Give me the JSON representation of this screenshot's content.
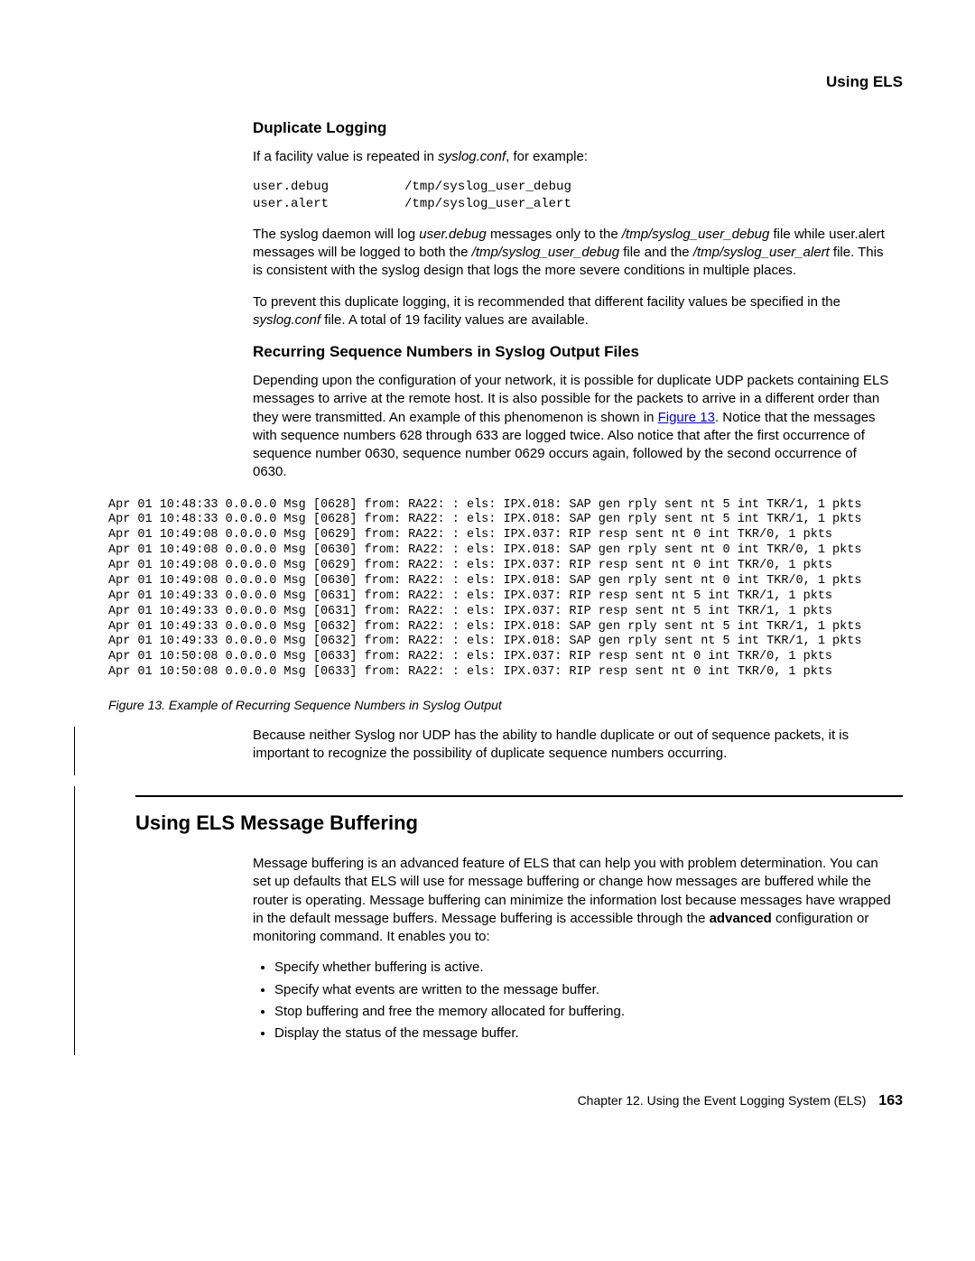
{
  "header": {
    "right": "Using ELS"
  },
  "sec1": {
    "title": "Duplicate Logging",
    "p1a": "If a facility value is repeated in ",
    "p1b": "syslog.conf",
    "p1c": ", for example:",
    "code": "user.debug          /tmp/syslog_user_debug\nuser.alert          /tmp/syslog_user_alert",
    "p2a": "The syslog daemon will log ",
    "p2b": "user.debug",
    "p2c": " messages only to the ",
    "p2d": "/tmp/syslog_user_debug",
    "p2e": " file while user.alert messages will be logged to both the ",
    "p2f": "/tmp/syslog_user_debug",
    "p2g": " file and the ",
    "p2h": "/tmp/syslog_user_alert",
    "p2i": " file. This is consistent with the syslog design that logs the more severe conditions in multiple places.",
    "p3a": "To prevent this duplicate logging, it is recommended that different facility values be specified in the ",
    "p3b": "syslog.conf",
    "p3c": " file. A total of 19 facility values are available."
  },
  "sec2": {
    "title": "Recurring Sequence Numbers in Syslog Output Files",
    "p1a": "Depending upon the configuration of your network, it is possible for duplicate UDP packets containing ELS messages to arrive at the remote host. It is also possible for the packets to arrive in a different order than they were transmitted. An example of this phenomenon is shown in ",
    "p1link": "Figure 13",
    "p1b": ". Notice that the messages with sequence numbers 628 through 633 are logged twice. Also notice that after the first occurrence of sequence number 0630, sequence number 0629 occurs again, followed by the second occurrence of 0630."
  },
  "log": "Apr 01 10:48:33 0.0.0.0 Msg [0628] from: RA22: : els: IPX.018: SAP gen rply sent nt 5 int TKR/1, 1 pkts\nApr 01 10:48:33 0.0.0.0 Msg [0628] from: RA22: : els: IPX.018: SAP gen rply sent nt 5 int TKR/1, 1 pkts\nApr 01 10:49:08 0.0.0.0 Msg [0629] from: RA22: : els: IPX.037: RIP resp sent nt 0 int TKR/0, 1 pkts\nApr 01 10:49:08 0.0.0.0 Msg [0630] from: RA22: : els: IPX.018: SAP gen rply sent nt 0 int TKR/0, 1 pkts\nApr 01 10:49:08 0.0.0.0 Msg [0629] from: RA22: : els: IPX.037: RIP resp sent nt 0 int TKR/0, 1 pkts\nApr 01 10:49:08 0.0.0.0 Msg [0630] from: RA22: : els: IPX.018: SAP gen rply sent nt 0 int TKR/0, 1 pkts\nApr 01 10:49:33 0.0.0.0 Msg [0631] from: RA22: : els: IPX.037: RIP resp sent nt 5 int TKR/1, 1 pkts\nApr 01 10:49:33 0.0.0.0 Msg [0631] from: RA22: : els: IPX.037: RIP resp sent nt 5 int TKR/1, 1 pkts\nApr 01 10:49:33 0.0.0.0 Msg [0632] from: RA22: : els: IPX.018: SAP gen rply sent nt 5 int TKR/1, 1 pkts\nApr 01 10:49:33 0.0.0.0 Msg [0632] from: RA22: : els: IPX.018: SAP gen rply sent nt 5 int TKR/1, 1 pkts\nApr 01 10:50:08 0.0.0.0 Msg [0633] from: RA22: : els: IPX.037: RIP resp sent nt 0 int TKR/0, 1 pkts\nApr 01 10:50:08 0.0.0.0 Msg [0633] from: RA22: : els: IPX.037: RIP resp sent nt 0 int TKR/0, 1 pkts",
  "figcap": "Figure 13. Example of Recurring Sequence Numbers in Syslog Output",
  "afterfig": "Because neither Syslog nor UDP has the ability to handle duplicate or out of sequence packets, it is important to recognize the possibility of duplicate sequence numbers occurring.",
  "sec3": {
    "title": "Using ELS Message Buffering",
    "p1a": "Message buffering is an advanced feature of ELS that can help you with problem determination. You can set up defaults that ELS will use for message buffering or change how messages are buffered while the router is operating. Message buffering can minimize the information lost because messages have wrapped in the default message buffers. Message buffering is accessible through the ",
    "p1b": "advanced",
    "p1c": " configuration or monitoring command. It enables you to:",
    "bullets": [
      "Specify whether buffering is active.",
      "Specify what events are written to the message buffer.",
      "Stop buffering and free the memory allocated for buffering.",
      "Display the status of the message buffer."
    ]
  },
  "footer": {
    "chapter": "Chapter 12. Using the Event Logging System (ELS)",
    "page": "163"
  }
}
